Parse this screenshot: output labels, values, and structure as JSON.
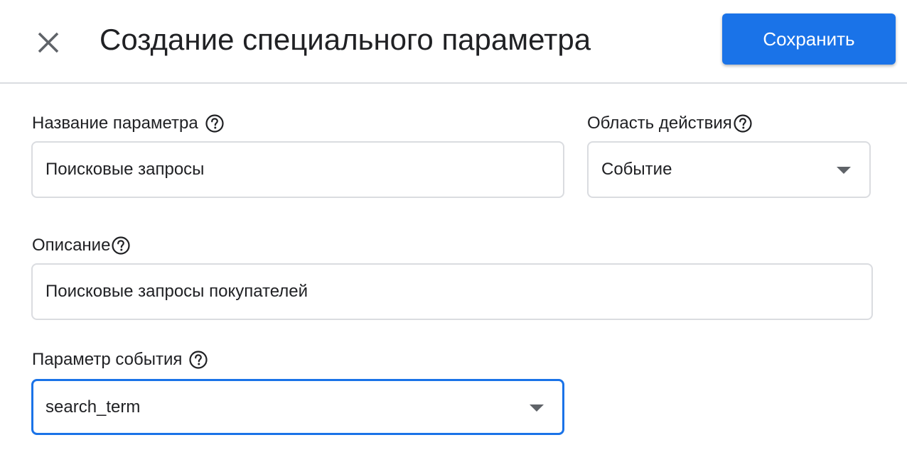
{
  "header": {
    "title": "Создание специального параметра",
    "save_label": "Сохранить",
    "close_icon": "close-icon"
  },
  "form": {
    "name": {
      "label": "Название параметра",
      "value": "Поисковые запросы",
      "help_icon": "help-icon"
    },
    "scope": {
      "label": "Область действия",
      "value": "Событие",
      "help_icon": "help-icon"
    },
    "description": {
      "label": "Описание",
      "value": "Поисковые запросы покупателей",
      "help_icon": "help-icon"
    },
    "event_parameter": {
      "label": "Параметр события",
      "value": "search_term",
      "help_icon": "help-icon"
    }
  },
  "colors": {
    "accent": "#1a73e8",
    "border": "#dadce0",
    "text": "#202124",
    "icon": "#5f6368"
  }
}
